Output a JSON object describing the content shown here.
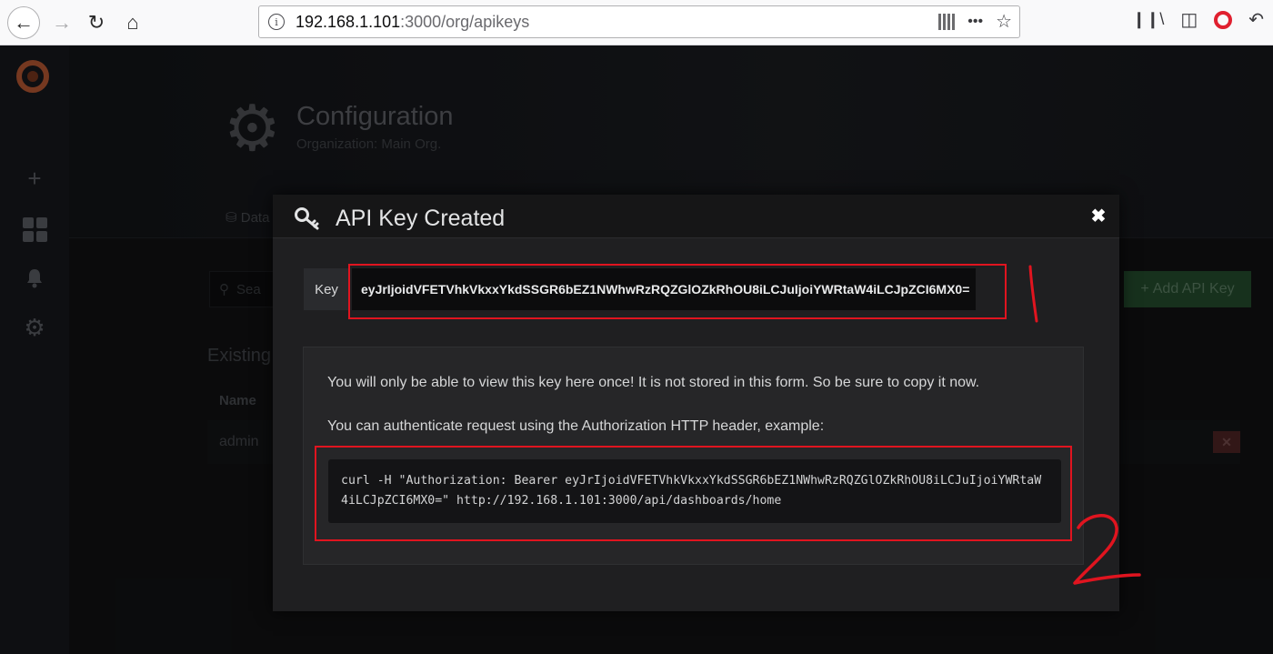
{
  "browser": {
    "url_host": "192.168.1.101",
    "url_path": ":3000/org/apikeys",
    "menu_label": "•••"
  },
  "page": {
    "title": "Configuration",
    "subtitle": "Organization: Main Org.",
    "tab_data_label": "Data",
    "search_placeholder": "Sea",
    "existing_heading": "Existing",
    "column_name": "Name",
    "row_name": "admin",
    "add_button_label": "Add API Key"
  },
  "modal": {
    "title": "API Key Created",
    "key_label": "Key",
    "key_value": "eyJrIjoidVFETVhkVkxxYkdSSGR6bEZ1NWhwRzRQZGlOZkRhOU8iLCJuIjoiYWRtaW4iLCJpZCI6MX0=",
    "info_text": "You will only be able to view this key here once! It is not stored in this form. So be sure to copy it now.",
    "auth_text": "You can authenticate request using the Authorization HTTP header, example:",
    "curl_example": "curl -H \"Authorization: Bearer eyJrIjoidVFETVhkVkxxYkdSSGR6bEZ1NWhwRzRQZGlOZkRhOU8iLCJuIjoiYWRtaW4iLCJpZCI6MX0=\" http://192.168.1.101:3000/api/dashboards/home"
  },
  "annotations": {
    "mark_1": "1",
    "mark_2": "2",
    "color": "#e0141f"
  },
  "colors": {
    "accent_green": "#2b5a36",
    "danger": "#5b2a2a",
    "grafana_orange": "#d6673b"
  }
}
